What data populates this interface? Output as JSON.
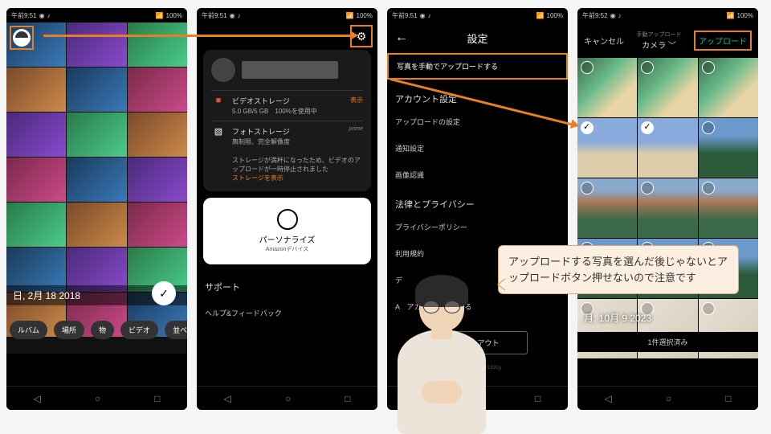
{
  "screen1": {
    "time": "午前9:51",
    "battery": "100%",
    "date_label": "日, 2月 18 2018",
    "filters": [
      "ルバム",
      "場所",
      "物",
      "ビデオ",
      "並べ替え"
    ]
  },
  "screen2": {
    "time": "午前9:51",
    "battery": "100%",
    "video_storage": {
      "title": "ビデオストレージ",
      "detail": "5.0 GB/5 GB　100%を使用中",
      "action": "表示"
    },
    "photo_storage": {
      "title": "フォトストレージ",
      "detail": "無制限、完全解像度",
      "action": "prime"
    },
    "warning_text": "ストレージが満杯になったため、ビデオのアップロードが一時停止されました",
    "warning_link": "ストレージを表示",
    "personalize": {
      "title": "パーソナライズ",
      "sub": "Amazonデバイス"
    },
    "support_header": "サポート",
    "help_item": "ヘルプ&フィードバック"
  },
  "screen3": {
    "time": "午前9:51",
    "battery": "100%",
    "title": "設定",
    "manual_upload": "写真を手動でアップロードする",
    "sections": {
      "account": "アカウント設定",
      "legal": "法律とプライバシー"
    },
    "items": {
      "upload_settings": "アップロードの設定",
      "notify": "通知設定",
      "image_rec": "画像認識",
      "privacy": "プライバシーポリシー",
      "terms": "利用規約",
      "third_party_prefix": "デ",
      "close_account_prefix": "A",
      "close_account_suffix": "アカウントを閉じる"
    },
    "signout": "サインアウト",
    "footer_id": "0-amzp-9021301891g"
  },
  "screen4": {
    "time": "午前9:52",
    "battery": "100%",
    "cancel": "キャンセル",
    "sub": "手動アップロード",
    "camera": "カメラ ﹀",
    "upload": "アップロード",
    "date_label": "月, 10月 9 2023",
    "selection_status": "1件選択済み"
  },
  "speech_text": "アップロードする写真を選んだ後じゃないとアップロードボタン押せないので注意です"
}
